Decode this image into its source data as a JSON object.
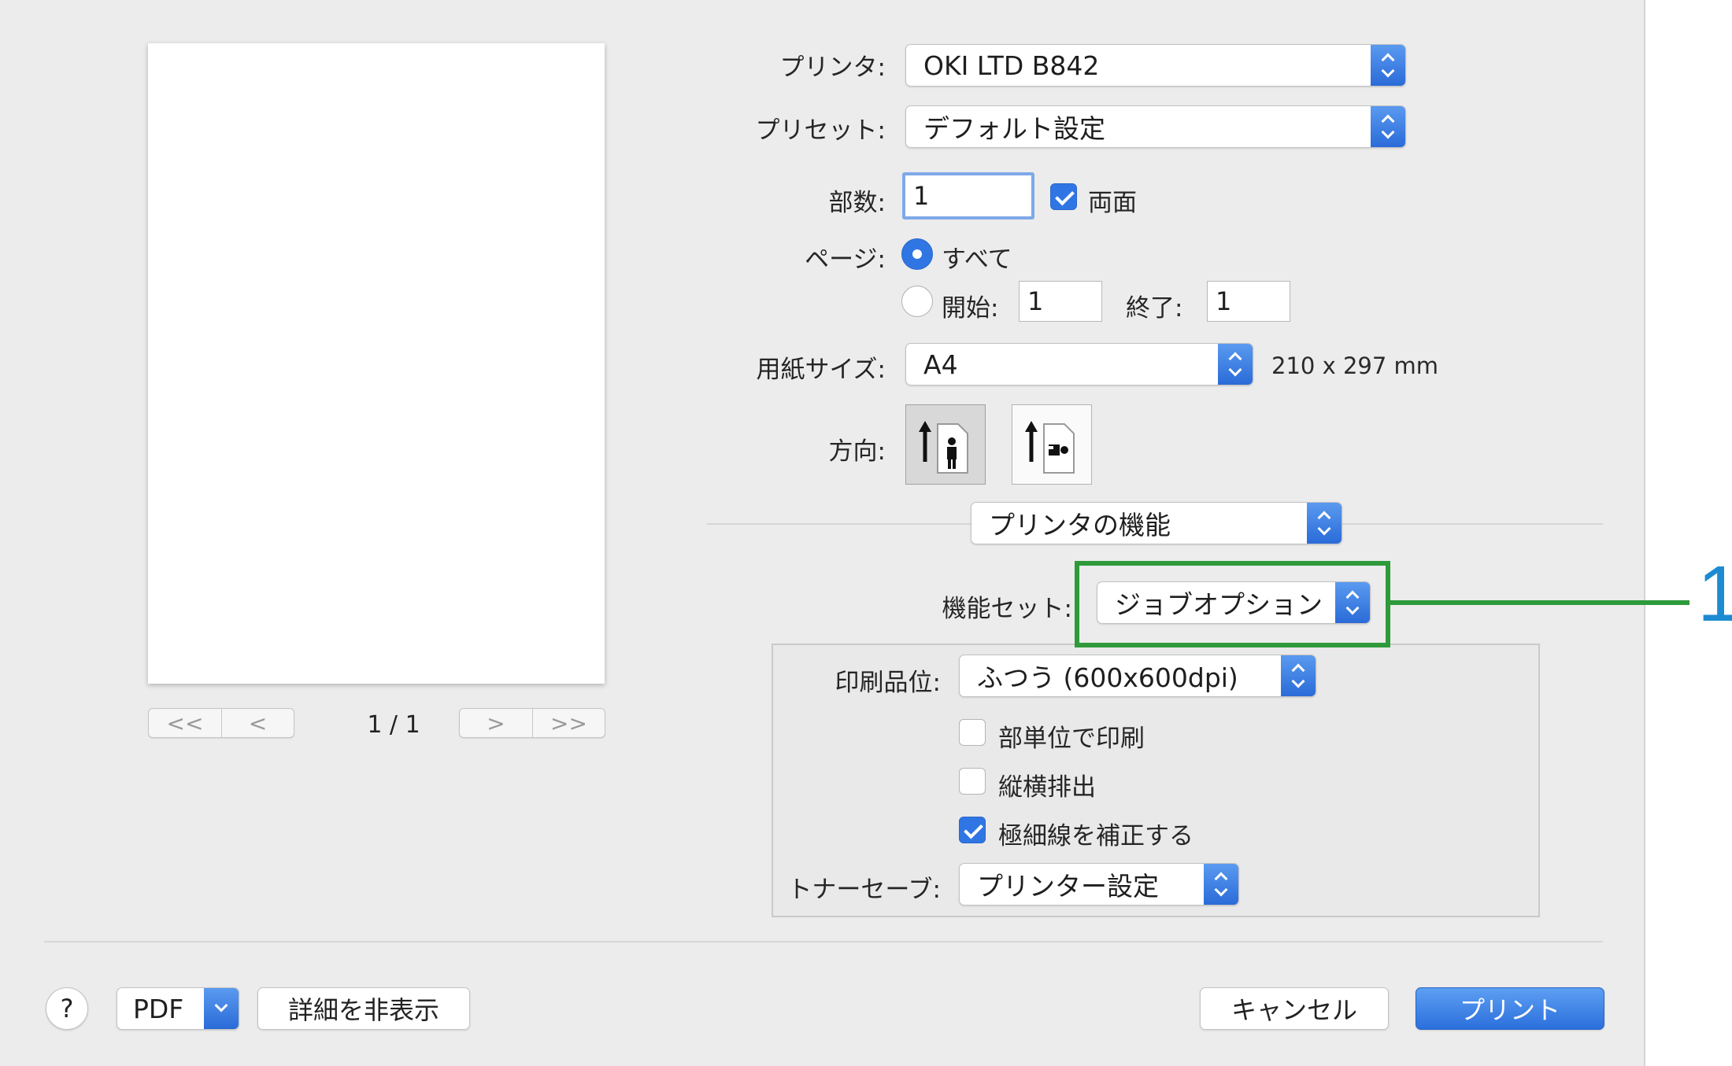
{
  "preview": {
    "page_indicator": "1 / 1",
    "nav": {
      "first": "<<",
      "prev": "<",
      "next": ">",
      "last": ">>"
    }
  },
  "printer": {
    "label": "プリンタ:",
    "value": "OKI LTD B842"
  },
  "preset": {
    "label": "プリセット:",
    "value": "デフォルト設定"
  },
  "copies": {
    "label": "部数:",
    "value": "1",
    "duplex_label": "両面",
    "duplex_checked": true
  },
  "pages": {
    "label": "ページ:",
    "all_label": "すべて",
    "from_label": "開始:",
    "from_value": "1",
    "to_label": "終了:",
    "to_value": "1"
  },
  "paper_size": {
    "label": "用紙サイズ:",
    "value": "A4",
    "dimensions": "210 x 297 mm"
  },
  "orientation": {
    "label": "方向:"
  },
  "section_popup": {
    "value": "プリンタの機能"
  },
  "feature_set": {
    "label": "機能セット:",
    "value": "ジョブオプション"
  },
  "quality": {
    "label": "印刷品位:",
    "value": "ふつう (600x600dpi)"
  },
  "options": {
    "collate": {
      "label": "部単位で印刷",
      "checked": false
    },
    "offset": {
      "label": "縦横排出",
      "checked": false
    },
    "fine_line": {
      "label": "極細線を補正する",
      "checked": true
    }
  },
  "toner_save": {
    "label": "トナーセーブ:",
    "value": "プリンター設定"
  },
  "footer": {
    "help": "?",
    "pdf": "PDF",
    "hide_details": "詳細を非表示",
    "cancel": "キャンセル",
    "print": "プリント"
  },
  "callout": {
    "number": "1",
    "color": "#2e9a3a",
    "number_color": "#1d8bd1"
  }
}
